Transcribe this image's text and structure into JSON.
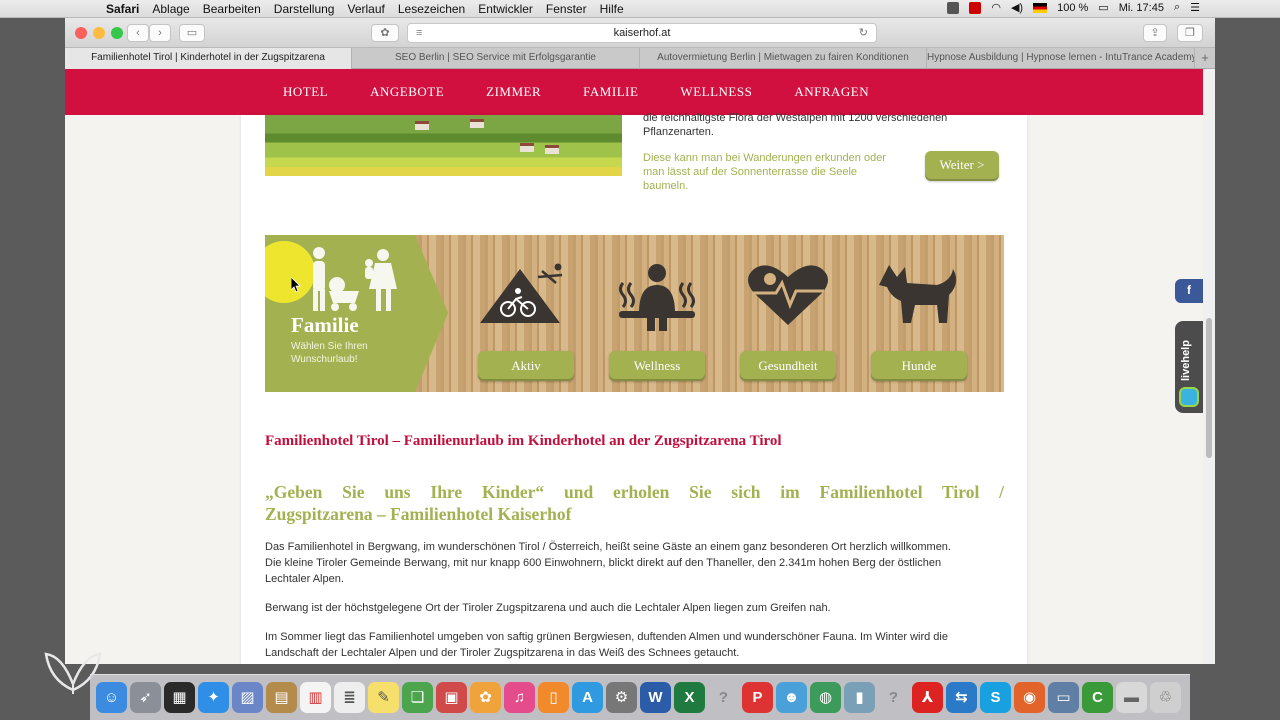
{
  "menubar": {
    "items": [
      "Safari",
      "Ablage",
      "Bearbeiten",
      "Darstellung",
      "Verlauf",
      "Lesezeichen",
      "Entwickler",
      "Fenster",
      "Hilfe"
    ],
    "battery": "100 %",
    "clock": "Mi. 17:45"
  },
  "browser": {
    "url": "kaiserhof.at",
    "tabs": [
      "Familienhotel Tirol | Kinderhotel in der Zugspitzarena",
      "SEO Berlin | SEO Service mit Erfolgsgarantie",
      "Autovermietung Berlin | Mietwagen zu fairen Konditionen",
      "Hypnose Ausbildung | Hypnose lernen - IntuTrance Academy"
    ],
    "new_tab": "+"
  },
  "nav": {
    "items": [
      "HOTEL",
      "ANGEBOTE",
      "ZIMMER",
      "FAMILIE",
      "WELLNESS",
      "ANFRAGEN"
    ]
  },
  "intro": {
    "text1_line1": "die reichhaltigste Flora der Westalpen mit 1200 verschiedenen",
    "text1_line2": "Pflanzenarten.",
    "text2_line1": "Diese kann man bei Wanderungen erkunden oder",
    "text2_line2": "man lässt auf der Sonnenterrasse die Seele",
    "text2_line3": "baumeln.",
    "button": "Weiter >"
  },
  "banner": {
    "title": "Familie",
    "subtitle_line1": "Wählen Sie Ihren",
    "subtitle_line2": "Wunschurlaub!",
    "categories": [
      "Aktiv",
      "Wellness",
      "Gesundheit",
      "Hunde"
    ],
    "colors": {
      "green": "#a3b151",
      "wood": "#c8a372"
    }
  },
  "article": {
    "heading": "Familienhotel Tirol – Familienurlaub im Kinderhotel an der Zugspitzarena Tirol",
    "subheading_line1": "„Geben Sie uns Ihre Kinder“ und erholen Sie sich im Familienhotel Tirol /",
    "subheading_line2": "Zugspitzarena – Familienhotel Kaiserhof",
    "p1_line1": "Das Familienhotel in Bergwang, im wunderschönen Tirol / Österreich, heißt seine Gäste an einem ganz besonderen Ort herzlich willkommen.",
    "p1_line2": "Die kleine Tiroler Gemeinde Berwang, mit nur knapp 600 Einwohnern, blickt direkt auf den Thaneller, den 2.341m hohen Berg der östlichen",
    "p1_line3": "Lechtaler Alpen.",
    "p2": "Berwang ist der höchstgelegene Ort der Tiroler Zugspitzarena und auch die Lechtaler Alpen liegen zum Greifen nah.",
    "p3_line1": "Im Sommer liegt das Familienhotel umgeben von saftig grünen Bergwiesen, duftenden Almen und wunderschöner Fauna. Im Winter wird die",
    "p3_line2": "Landschaft der Lechtaler Alpen und der Tiroler Zugspitzarena in das Weiß des Schnees getaucht."
  },
  "widgets": {
    "facebook": "f",
    "livehelp": "livehelp"
  },
  "colors": {
    "nav_red": "#d11040",
    "heading_red": "#c20f3c",
    "accent_green": "#a3b151"
  }
}
